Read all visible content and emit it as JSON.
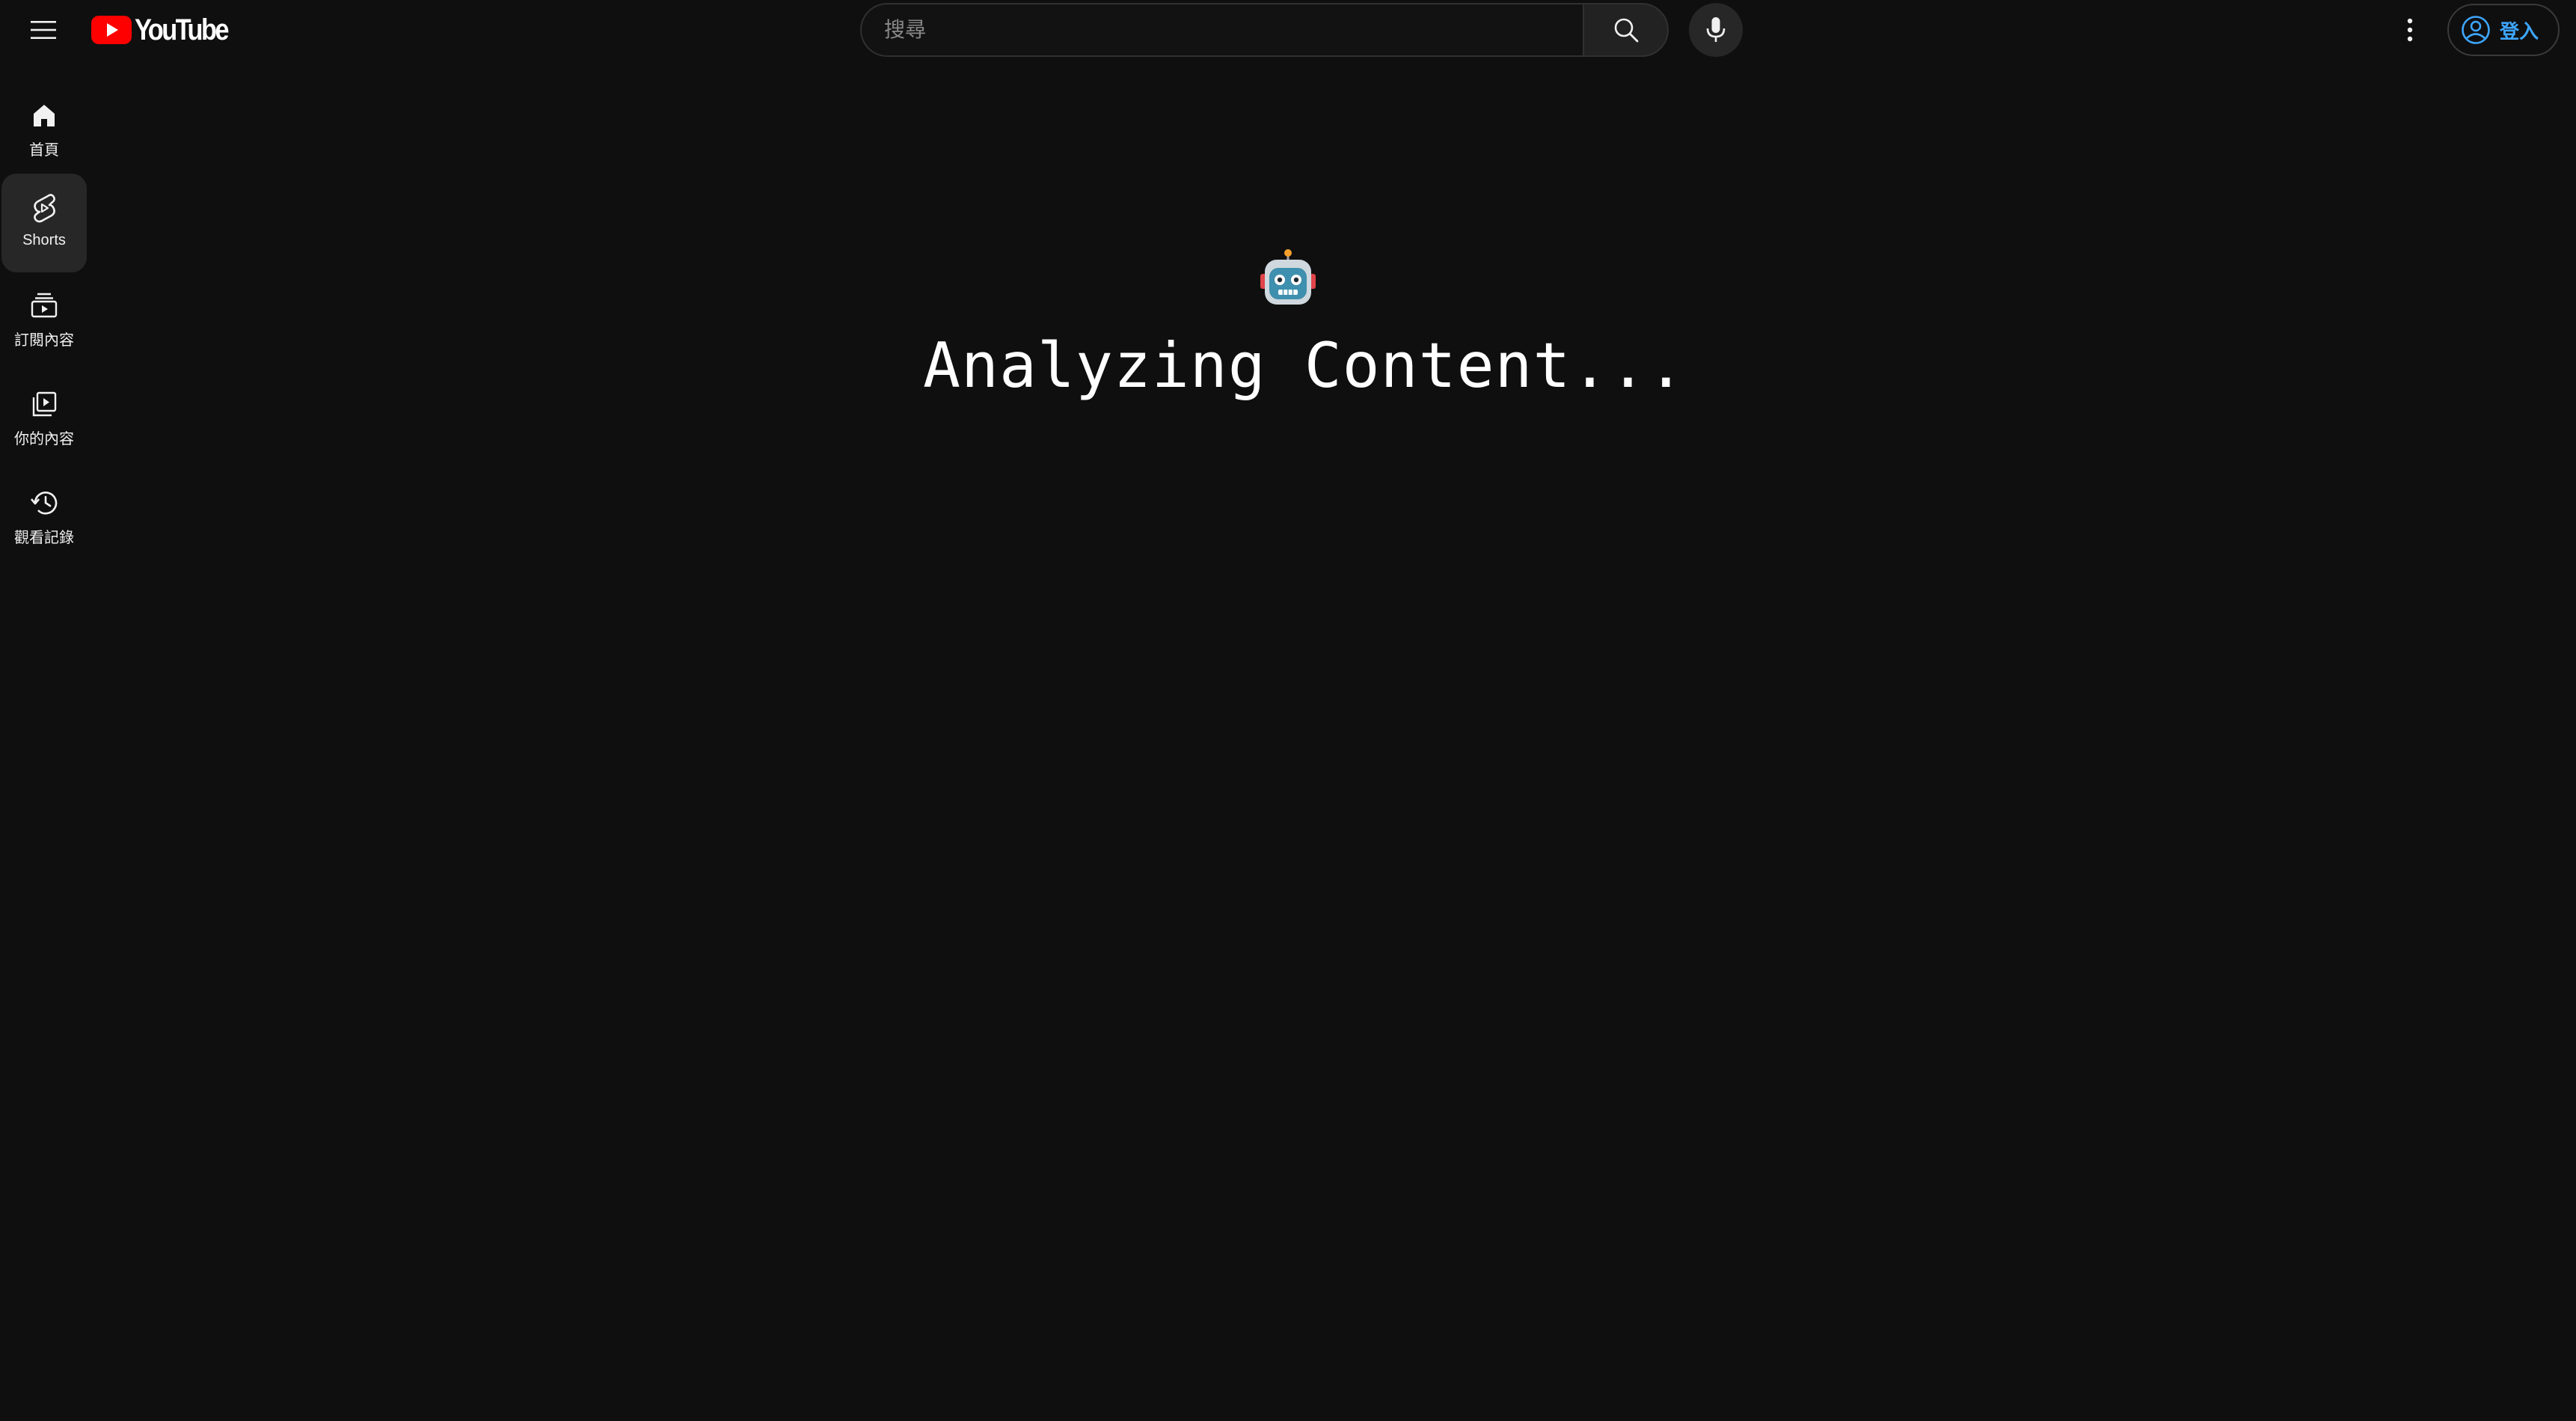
{
  "header": {
    "logo_text": "YouTube",
    "search": {
      "placeholder": "搜尋",
      "value": ""
    },
    "signin_label": "登入",
    "icons": {
      "menu": "hamburger-menu-icon",
      "search": "search-icon",
      "mic": "microphone-icon",
      "more": "vertical-dots-icon",
      "account": "account-circle-icon"
    }
  },
  "sidebar": {
    "items": [
      {
        "label": "首頁",
        "icon": "home-icon",
        "active": false
      },
      {
        "label": "Shorts",
        "icon": "shorts-icon",
        "active": true
      },
      {
        "label": "訂閱內容",
        "icon": "subscriptions-icon",
        "active": false
      },
      {
        "label": "你的內容",
        "icon": "your-content-icon",
        "active": false
      },
      {
        "label": "觀看記錄",
        "icon": "history-icon",
        "active": false
      }
    ]
  },
  "main": {
    "status_icon": "robot-icon",
    "status_text": "Analyzing Content..."
  },
  "colors": {
    "background": "#0f0f0f",
    "brand_red": "#ff0000",
    "link_blue": "#3ea6ff",
    "active_nav": "#272727"
  }
}
